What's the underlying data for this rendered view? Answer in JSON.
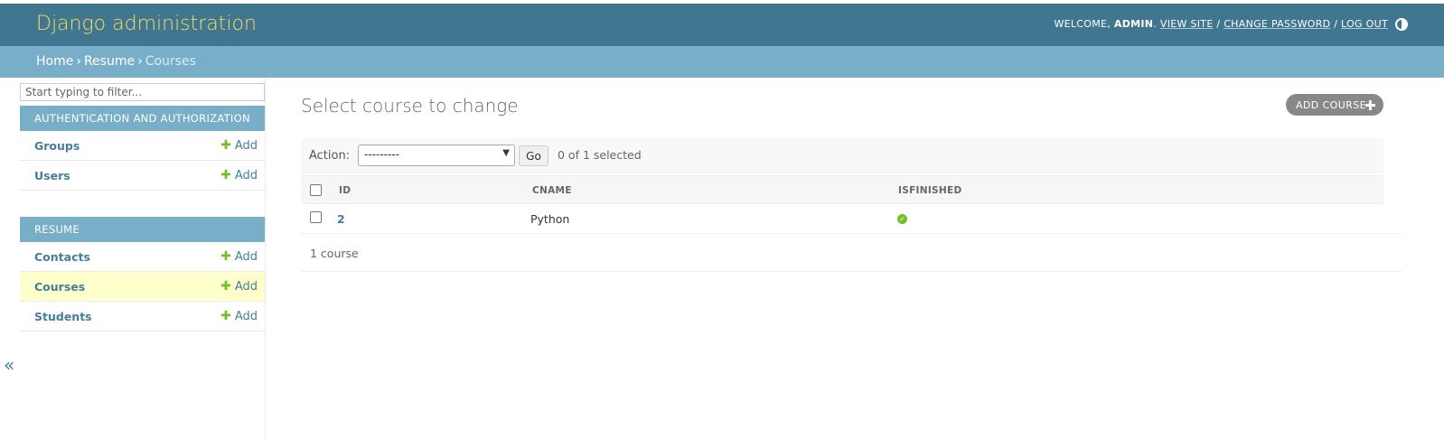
{
  "header": {
    "branding": "Django administration",
    "welcome": "WELCOME,",
    "username": "ADMIN",
    "view_site": "VIEW SITE",
    "change_password": "CHANGE PASSWORD",
    "log_out": "LOG OUT",
    "sep": "/"
  },
  "breadcrumbs": {
    "home": "Home",
    "app": "Resume",
    "current": "Courses",
    "separator": "›"
  },
  "sidebar": {
    "filter_placeholder": "Start typing to filter...",
    "apps": [
      {
        "caption": "AUTHENTICATION AND AUTHORIZATION",
        "models": [
          {
            "name": "Groups",
            "add": "Add"
          },
          {
            "name": "Users",
            "add": "Add"
          }
        ]
      },
      {
        "caption": "RESUME",
        "models": [
          {
            "name": "Contacts",
            "add": "Add"
          },
          {
            "name": "Courses",
            "add": "Add"
          },
          {
            "name": "Students",
            "add": "Add"
          }
        ]
      }
    ],
    "collapse": "«"
  },
  "content": {
    "title": "Select course to change",
    "add_button": "ADD COURSE",
    "action_label": "Action:",
    "action_selected": "---------",
    "go": "Go",
    "selection_count": "0 of 1 selected",
    "columns": [
      "ID",
      "CNAME",
      "ISFINISHED"
    ],
    "rows": [
      {
        "id": "2",
        "cname": "Python",
        "isfinished": true
      }
    ],
    "paginator": "1 course"
  },
  "colors": {
    "header": "#417690",
    "breadcrumbs": "#79aec8",
    "branding": "#f5dd5d",
    "link": "#447e9b",
    "add_green": "#70bf2b",
    "selected_row": "#ffffcc"
  }
}
